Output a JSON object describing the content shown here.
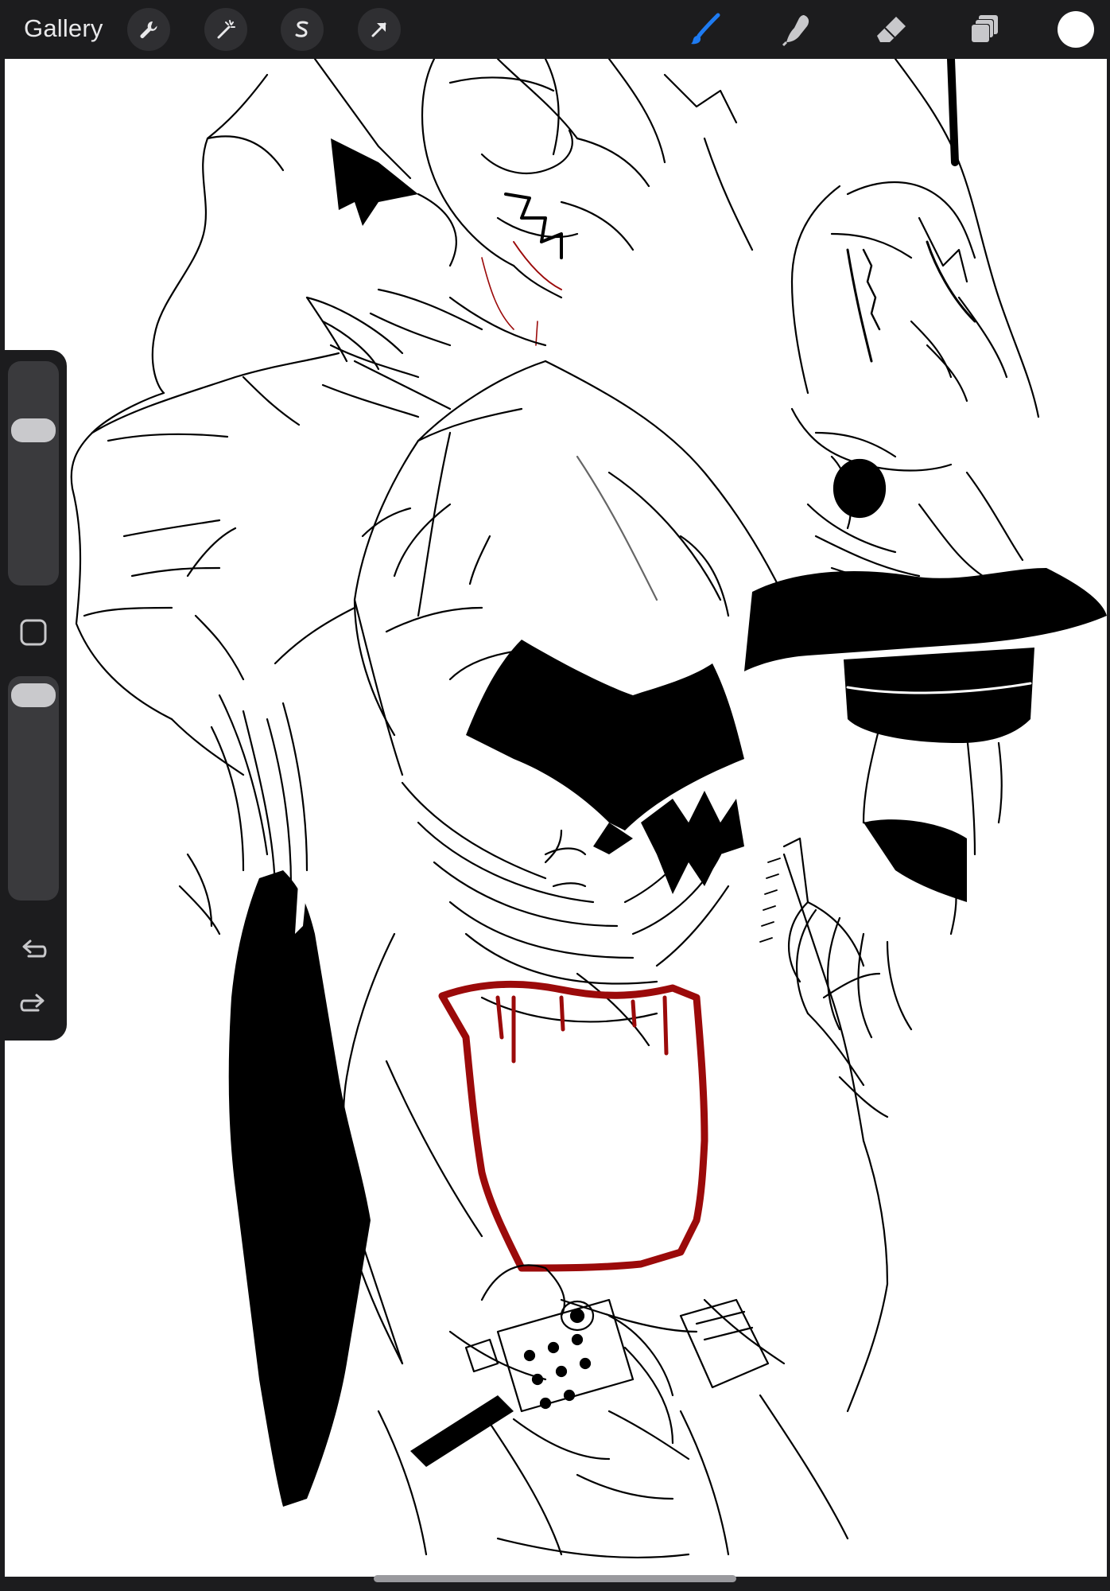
{
  "toolbar": {
    "gallery_label": "Gallery",
    "left_tools": [
      "wrench-icon",
      "magic-wand-icon",
      "selection-s-icon",
      "transform-arrow-icon"
    ],
    "right_tools": [
      "brush-icon",
      "smudge-icon",
      "eraser-icon",
      "layers-icon"
    ],
    "active_tool": "brush-icon",
    "active_color": "#ffffff",
    "accent_color": "#1e7bf2"
  },
  "sidebar": {
    "brush_size_level": 0.72,
    "opacity_level": 0.98,
    "icons": [
      "modify-square-icon",
      "undo-icon",
      "redo-icon"
    ]
  },
  "canvas": {
    "background": "#ffffff",
    "ink_color": "#000000",
    "accent_ink_color": "#9b0a0a"
  }
}
